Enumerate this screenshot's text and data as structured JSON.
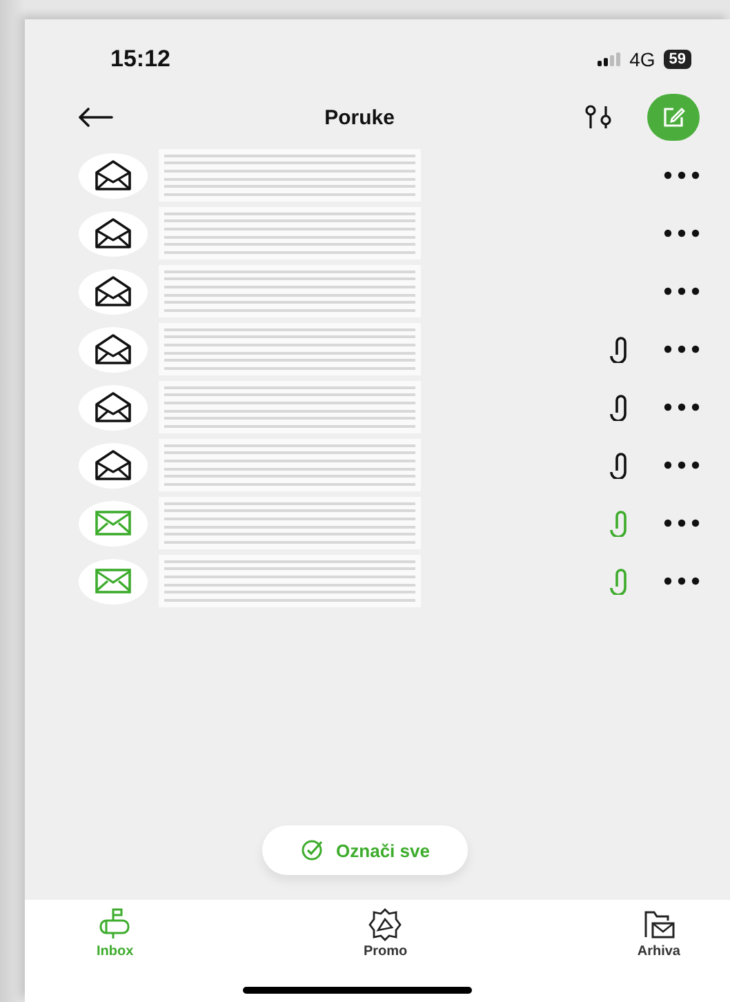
{
  "status_bar": {
    "time": "15:12",
    "network": "4G",
    "battery": "59"
  },
  "header": {
    "title": "Poruke"
  },
  "messages": [
    {
      "unread": false,
      "attachment": false
    },
    {
      "unread": false,
      "attachment": false
    },
    {
      "unread": false,
      "attachment": false
    },
    {
      "unread": false,
      "attachment": true
    },
    {
      "unread": false,
      "attachment": true
    },
    {
      "unread": false,
      "attachment": true
    },
    {
      "unread": true,
      "attachment": true
    },
    {
      "unread": true,
      "attachment": true
    }
  ],
  "select_all": {
    "label": "Označi sve"
  },
  "nav": [
    {
      "label": "Inbox",
      "kind": "mailbox",
      "selected": true
    },
    {
      "label": "Promo",
      "kind": "promo",
      "selected": false
    },
    {
      "label": "Arhiva",
      "kind": "archive",
      "selected": false
    }
  ]
}
